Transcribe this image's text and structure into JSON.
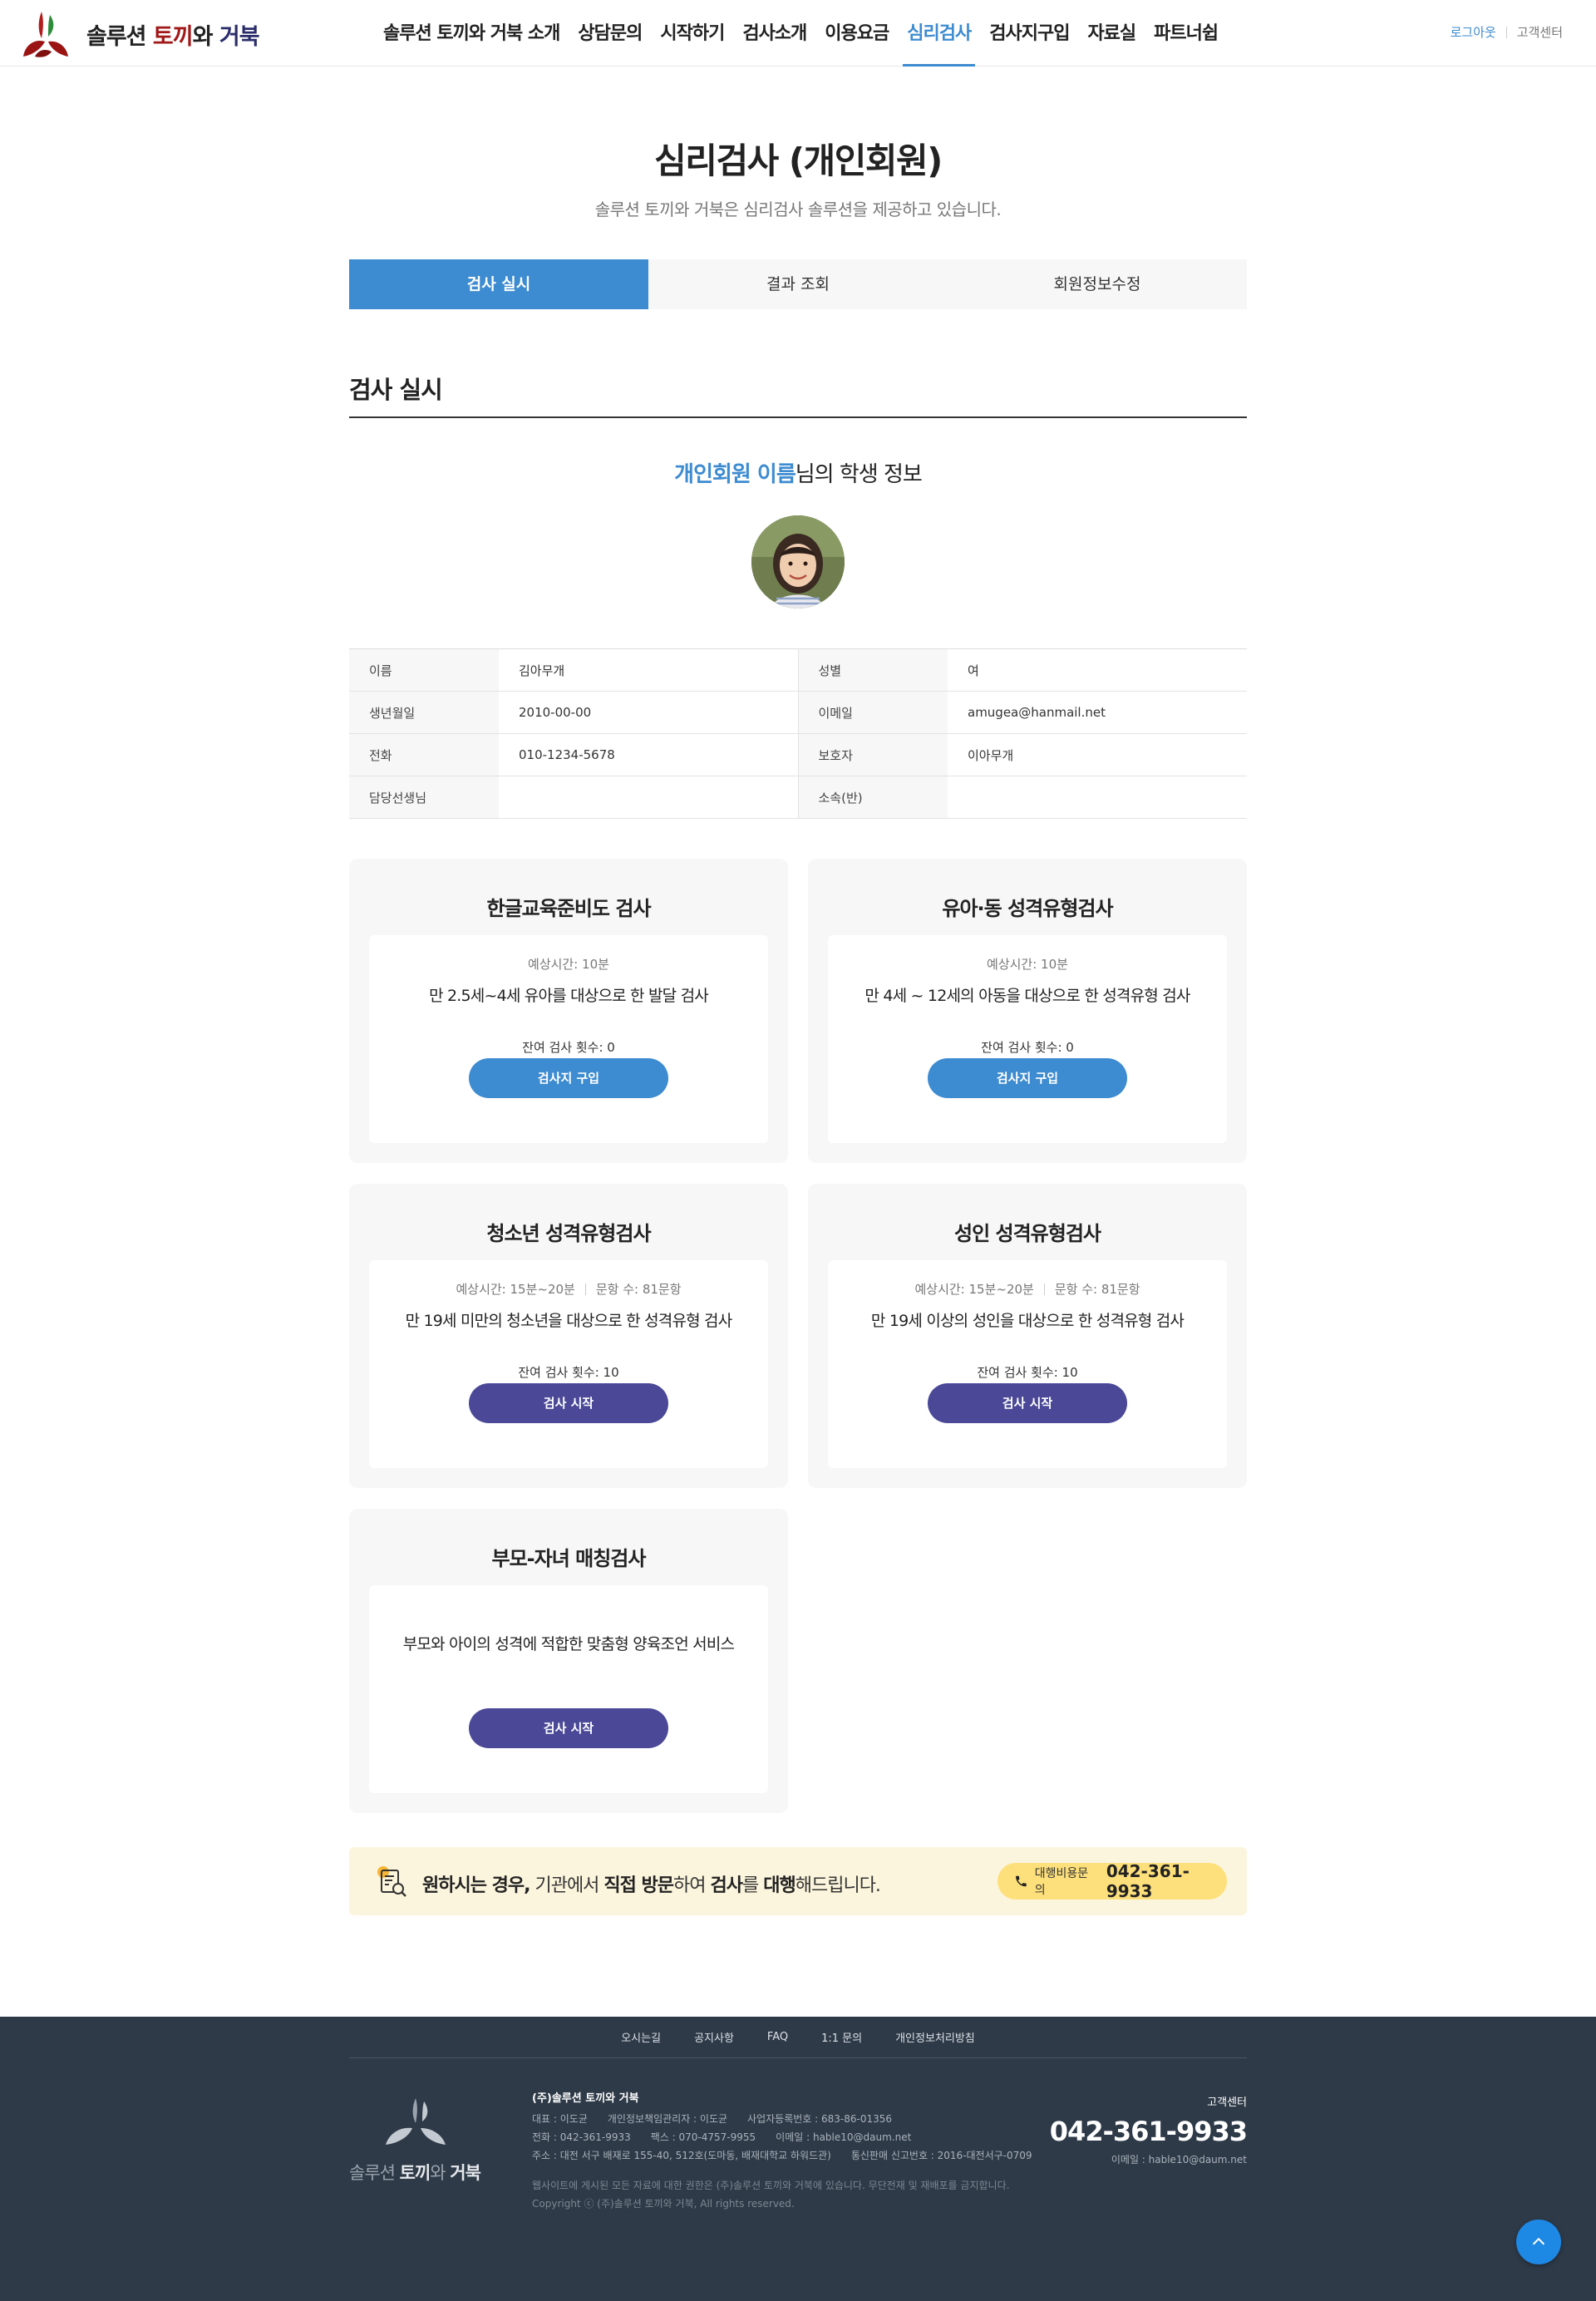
{
  "colors": {
    "accent": "#3d8bd0",
    "brand_red": "#a01818",
    "brand_navy": "#2a2d6a",
    "start_button": "#4a4897",
    "banner_bg": "#fcf5dd",
    "footer_bg": "#2e3a48",
    "top_button": "#1e88e5"
  },
  "header": {
    "logo": {
      "part1": "솔루션 ",
      "part2": "토끼",
      "part3": "와 ",
      "part4": "거북"
    },
    "nav": [
      "솔루션 토끼와 거북 소개",
      "상담문의",
      "시작하기",
      "검사소개",
      "이용요금",
      "심리검사",
      "검사지구입",
      "자료실",
      "파트너쉽"
    ],
    "active_nav": "심리검사",
    "util": {
      "logout": "로그아웃",
      "customer_center": "고객센터"
    }
  },
  "page": {
    "title": "심리검사 (개인회원)",
    "subtitle": "솔루션 토끼와 거북은 심리검사 솔루션을 제공하고 있습니다."
  },
  "tabs": [
    "검사 실시",
    "결과 조회",
    "회원정보수정"
  ],
  "section": {
    "title": "검사 실시",
    "student_heading": {
      "name": "개인회원 이름",
      "suffix": "님의 학생 정보"
    }
  },
  "student_info": [
    {
      "k1": "이름",
      "v1": "김아무개",
      "k2": "성별",
      "v2": "여"
    },
    {
      "k1": "생년월일",
      "v1": "2010-00-00",
      "k2": "이메일",
      "v2": "amugea@hanmail.net"
    },
    {
      "k1": "전화",
      "v1": "010-1234-5678",
      "k2": "보호자",
      "v2": "이아무개"
    },
    {
      "k1": "담당선생님",
      "v1": "",
      "k2": "소속(반)",
      "v2": ""
    }
  ],
  "tests": [
    {
      "title": "한글교육준비도 검사",
      "time": "예상시간: 10분",
      "questions": "",
      "desc": "만 2.5세~4세 유아를 대상으로 한 발달 검사",
      "remaining": "잔여 검사 횟수: 0",
      "button": "검사지 구입",
      "button_type": "buy"
    },
    {
      "title": "유아·동 성격유형검사",
      "time": "예상시간: 10분",
      "questions": "",
      "desc": "만 4세 ~ 12세의 아동을 대상으로 한 성격유형 검사",
      "remaining": "잔여 검사 횟수: 0",
      "button": "검사지 구입",
      "button_type": "buy"
    },
    {
      "title": "청소년 성격유형검사",
      "time": "예상시간: 15분~20분",
      "questions": "문항 수: 81문항",
      "desc": "만 19세 미만의 청소년을 대상으로 한 성격유형 검사",
      "remaining": "잔여 검사 횟수: 10",
      "button": "검사 시작",
      "button_type": "start"
    },
    {
      "title": "성인 성격유형검사",
      "time": "예상시간: 15분~20분",
      "questions": "문항 수: 81문항",
      "desc": "만 19세 이상의 성인을 대상으로 한 성격유형 검사",
      "remaining": "잔여 검사 횟수: 10",
      "button": "검사 시작",
      "button_type": "start"
    },
    {
      "title": "부모-자녀 매칭검사",
      "time": "",
      "questions": "",
      "desc": "부모와 아이의 성격에 적합한 맞춤형 양육조언 서비스",
      "remaining": "",
      "button": "검사 시작",
      "button_type": "start"
    }
  ],
  "banner": {
    "b1": "원하시는 경우,",
    "t1": " 기관에서 ",
    "b2": "직접 방문",
    "t2": "하여 ",
    "b3": "검사",
    "t3": "를 ",
    "b4": "대행",
    "t4": "해드립니다.",
    "pill_label": "대행비용문의",
    "pill_phone": "042-361-9933"
  },
  "footer": {
    "links": [
      "오시는길",
      "공지사항",
      "FAQ",
      "1:1 문의",
      "개인정보처리방침"
    ],
    "logo": {
      "part1": "솔루션 ",
      "part2": "토끼",
      "part3": "와 ",
      "part4": "거북"
    },
    "company": "(주)솔루션 토끼와 거북",
    "row1": [
      "대표 : 이도균",
      "개인정보책임관리자 : 이도균",
      "사업자등록번호 : 683-86-01356"
    ],
    "row2": [
      "전화 : 042-361-9933",
      "팩스 : 070-4757-9955",
      "이메일 : hable10@daum.net"
    ],
    "row3": [
      "주소 : 대전 서구 배재로 155-40, 512호(도마동, 배재대학교 하워드관)",
      "통신판매 신고번호 : 2016-대전서구-0709"
    ],
    "notice": "웹사이트에 게시된 모든 자료에 대한 권한은 (주)솔루션 토끼와 거북에 있습니다. 무단전재 및 재배포를 금지합니다.",
    "copyright": "Copyright ⓒ (주)솔루션 토끼와 거북, All rights reserved.",
    "cs_label": "고객센터",
    "cs_phone": "042-361-9933",
    "cs_mail": "이메일 : hable10@daum.net"
  }
}
